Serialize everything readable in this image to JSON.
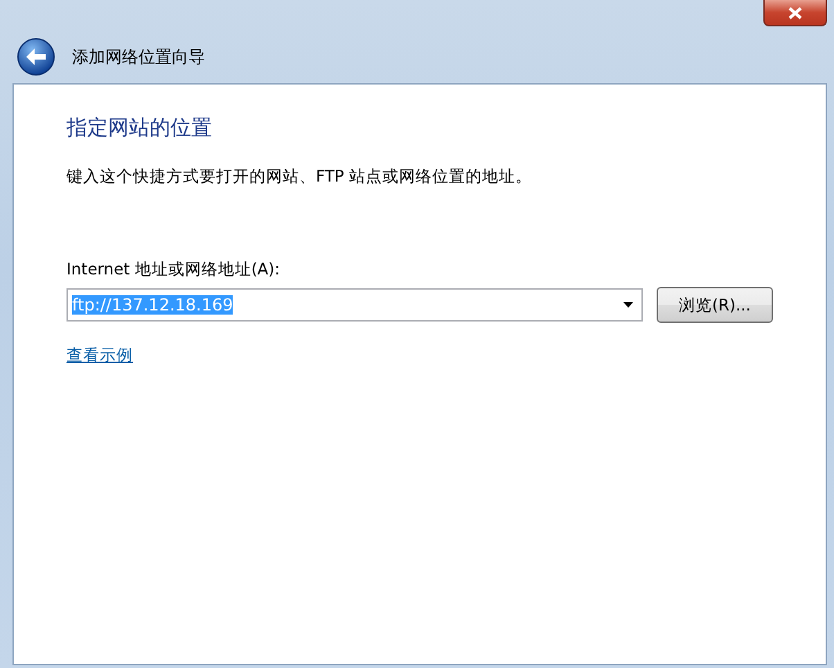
{
  "window": {
    "title": "添加网络位置向导"
  },
  "page": {
    "heading": "指定网站的位置",
    "description": "键入这个快捷方式要打开的网站、FTP 站点或网络位置的地址。",
    "address": {
      "label": "Internet 地址或网络地址(A):",
      "value": "ftp://137.12.18.169",
      "value_selected": true
    },
    "browse_button": "浏览(R)...",
    "example_link": "查看示例"
  }
}
